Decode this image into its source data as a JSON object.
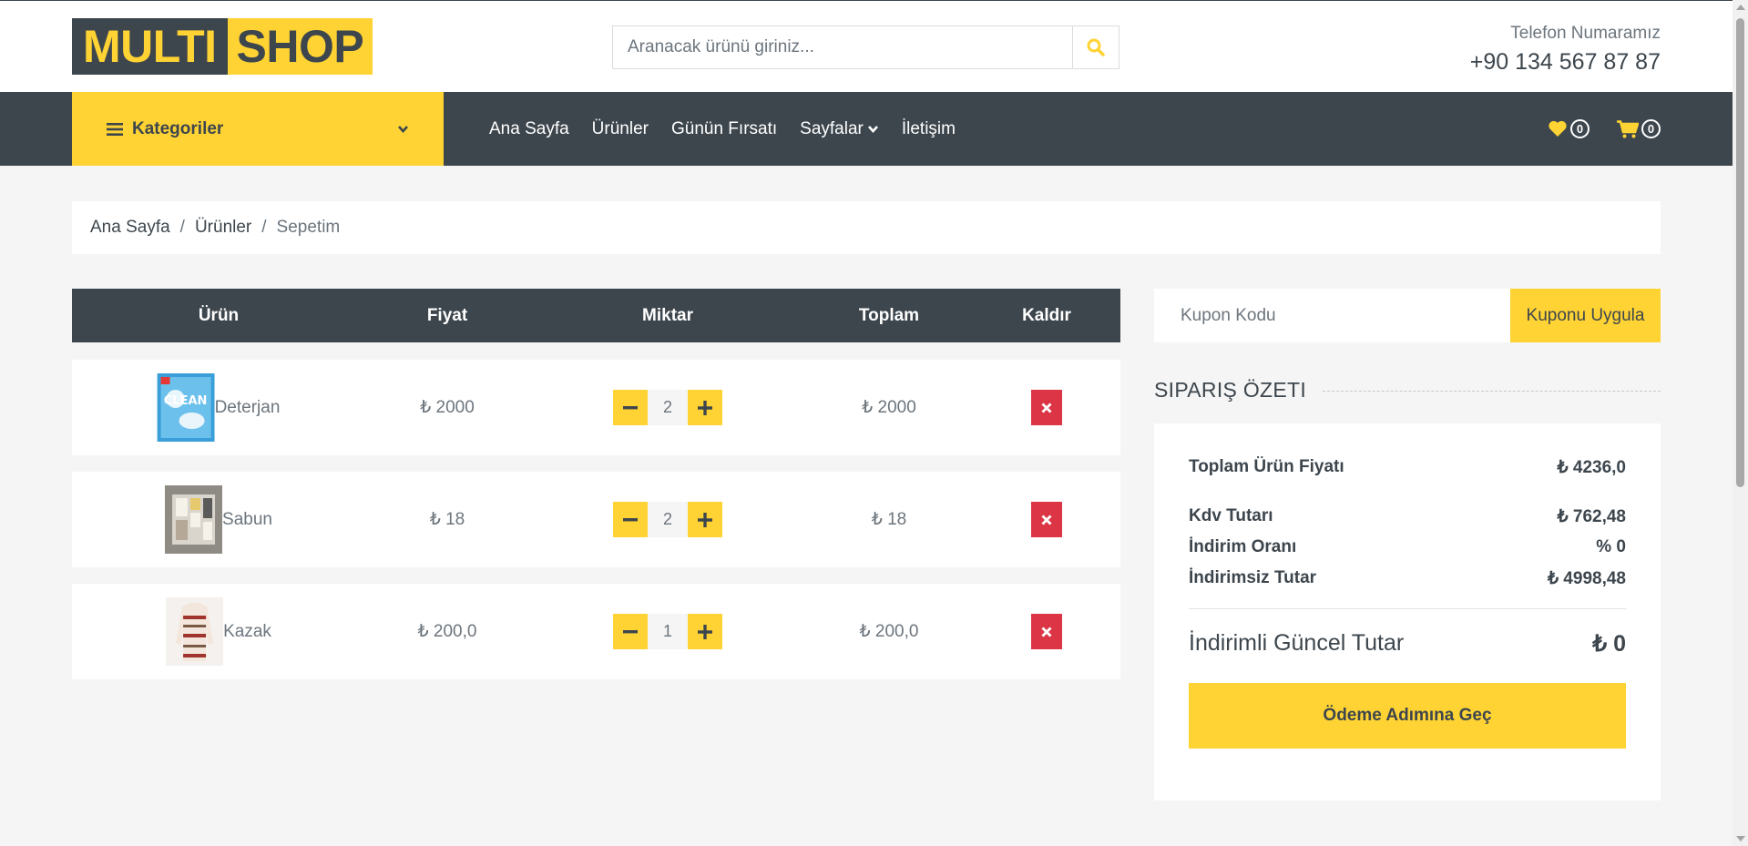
{
  "brand": {
    "part1": "MULTI",
    "part2": "SHOP"
  },
  "search": {
    "placeholder": "Aranacak ürünü giriniz..."
  },
  "contact": {
    "label": "Telefon Numaramız",
    "phone": "+90 134 567 87 87"
  },
  "nav": {
    "categories_label": "Kategoriler",
    "links": [
      "Ana Sayfa",
      "Ürünler",
      "Günün Fırsatı",
      "Sayfalar",
      "İletişim"
    ],
    "wishlist_count": "0",
    "cart_count": "0"
  },
  "breadcrumb": {
    "items": [
      "Ana Sayfa",
      "Ürünler"
    ],
    "current": "Sepetim",
    "separator": "/"
  },
  "cart": {
    "headers": [
      "Ürün",
      "Fiyat",
      "Miktar",
      "Toplam",
      "Kaldır"
    ],
    "rows": [
      {
        "name": "Deterjan",
        "price": "₺ 2000",
        "qty": "2",
        "total": "₺ 2000"
      },
      {
        "name": "Sabun",
        "price": "₺ 18",
        "qty": "2",
        "total": "₺ 18"
      },
      {
        "name": "Kazak",
        "price": "₺ 200,0",
        "qty": "1",
        "total": "₺ 200,0"
      }
    ]
  },
  "coupon": {
    "placeholder": "Kupon Kodu",
    "button": "Kuponu Uygula"
  },
  "summary": {
    "title": "SIPARIŞ ÖZETI",
    "items": [
      {
        "label": "Toplam Ürün Fiyatı",
        "value": "₺ 4236,0"
      },
      {
        "label": "Kdv Tutarı",
        "value": "₺ 762,48"
      },
      {
        "label": "İndirim Oranı",
        "value": "% 0"
      },
      {
        "label": "İndirimsiz Tutar",
        "value": "₺ 4998,48"
      }
    ],
    "total_label": "İndirimli Güncel Tutar",
    "total_value": "₺ 0",
    "checkout_button": "Ödeme Adımına Geç"
  },
  "colors": {
    "accent": "#ffd333",
    "dark": "#3d464d",
    "danger": "#dc3545",
    "background": "#f5f5f5"
  }
}
